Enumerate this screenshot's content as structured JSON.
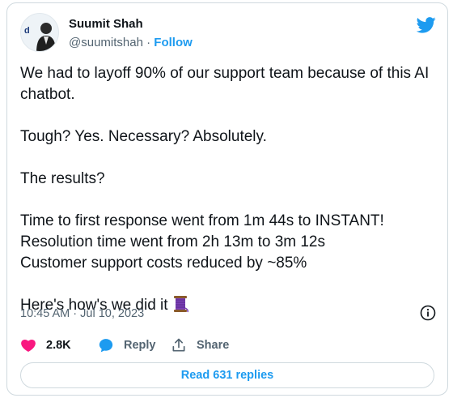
{
  "author": {
    "name": "Suumit Shah",
    "handle": "@suumitshah",
    "separator": " · ",
    "follow_label": "Follow",
    "avatar_text": "dukaan"
  },
  "tweet": {
    "paragraphs": [
      "We had to layoff 90% of our support team because of this AI chatbot.",
      "Tough? Yes. Necessary? Absolutely.",
      "The results?",
      "Time to first response went from 1m 44s to INSTANT!\nResolution time went from 2h 13m to 3m 12s\nCustomer support costs reduced by ~85%",
      "Here's how's we did it"
    ],
    "emoji": "thread-icon"
  },
  "meta": {
    "timestamp": "10:45 AM · Jul 10, 2023"
  },
  "actions": {
    "like_count": "2.8K",
    "reply_label": "Reply",
    "share_label": "Share"
  },
  "footer": {
    "read_replies_label": "Read 631 replies"
  },
  "colors": {
    "accent": "#1d9bf0",
    "like": "#f91880",
    "text": "#0f1419",
    "muted": "#536471",
    "border": "#cfd9de"
  }
}
